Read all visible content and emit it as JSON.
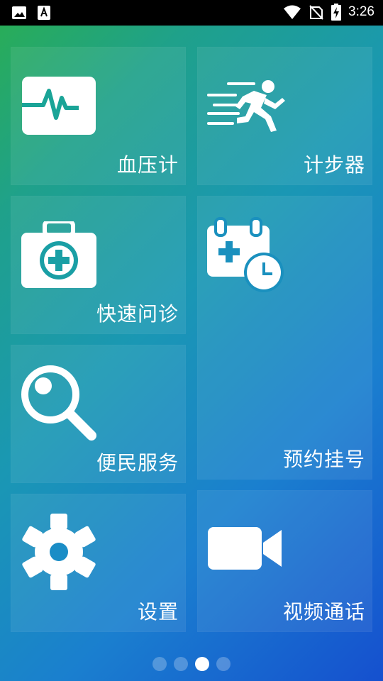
{
  "status_bar": {
    "time": "3:26",
    "icons": [
      "image-icon",
      "font-icon",
      "wifi-icon",
      "no-sim-icon",
      "battery-charging-icon"
    ]
  },
  "tiles": [
    {
      "label": "血压计",
      "icon": "heart-monitor-icon"
    },
    {
      "label": "计步器",
      "icon": "running-icon"
    },
    {
      "label": "快速问诊",
      "icon": "medical-kit-icon"
    },
    {
      "label": "预约挂号",
      "icon": "calendar-clock-icon"
    },
    {
      "label": "便民服务",
      "icon": "magnifier-icon"
    },
    {
      "label": "设置",
      "icon": "gear-icon"
    },
    {
      "label": "视频通话",
      "icon": "video-camera-icon"
    }
  ],
  "pager": {
    "count": 4,
    "active_index": 2
  },
  "colors": {
    "tile_overlay": "#ffffff14",
    "icon": "#ffffff",
    "gradient_start": "#2aae52",
    "gradient_end": "#1550cf"
  }
}
